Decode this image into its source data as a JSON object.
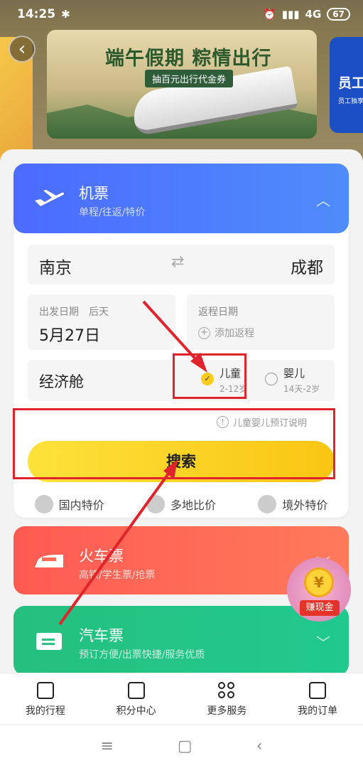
{
  "status": {
    "time": "14:25",
    "network": "4G",
    "battery": "67"
  },
  "banner": {
    "title": "端午假期 粽情出行",
    "coupon": "抽百元出行代金券",
    "right_title": "员工",
    "right_sub": "员工独享"
  },
  "flight": {
    "title": "机票",
    "subtitle": "单程/往返/特价",
    "from": "南京",
    "to": "成都",
    "depart_label": "出发日期",
    "depart_tag": "后天",
    "depart_date": "5月27日",
    "return_label": "返程日期",
    "return_add": "添加返程",
    "cabin": "经济舱",
    "child_label": "儿童",
    "child_age": "2-12岁",
    "infant_label": "婴儿",
    "infant_age": "14天-2岁",
    "note": "儿童婴儿预订说明",
    "search": "搜索",
    "features": [
      "国内特价",
      "多地比价",
      "境外特价"
    ]
  },
  "train": {
    "title": "火车票",
    "subtitle": "高铁/学生票/抢票"
  },
  "bus": {
    "title": "汽车票",
    "subtitle": "预订方便/出票快捷/服务优质"
  },
  "earn": {
    "label": "赚现金",
    "coin": "¥"
  },
  "nav": [
    "我的行程",
    "积分中心",
    "更多服务",
    "我的订单"
  ]
}
